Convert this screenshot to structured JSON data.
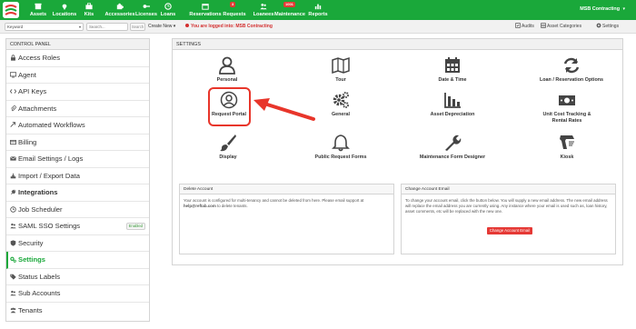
{
  "nav": {
    "items": [
      {
        "label": "Assets",
        "icon": "box-icon"
      },
      {
        "label": "Locations",
        "icon": "map-marker-icon"
      },
      {
        "label": "Kits",
        "icon": "briefcase-icon"
      },
      {
        "label": "Accessories",
        "icon": "puzzle-icon"
      },
      {
        "label": "Licenses",
        "icon": "key-icon"
      },
      {
        "label": "Loans",
        "icon": "clock-icon"
      },
      {
        "label": "Reservations",
        "icon": "calendar-icon"
      },
      {
        "label": "Requests",
        "icon": "envelope-icon",
        "badge": "3"
      },
      {
        "label": "Loanees",
        "icon": "users-icon"
      },
      {
        "label": "Maintenance",
        "icon": "wrench-icon",
        "badge": "1001"
      },
      {
        "label": "Reports",
        "icon": "chart-icon"
      }
    ],
    "user": "MSB Contracting",
    "accent": "#1aa83a"
  },
  "subbar": {
    "keyword": "Keyword",
    "search_placeholder": "Search...",
    "search_button": "Search",
    "create_new": "Create New",
    "logged_in": "You are logged into: MSB Contracting",
    "audits": "Audits",
    "asset_categories": "Asset Categories",
    "settings": "Settings"
  },
  "control_panel": {
    "title": "CONTROL PANEL",
    "items": [
      {
        "label": "Access Roles",
        "icon": "lock-icon"
      },
      {
        "label": "Agent",
        "icon": "monitor-icon"
      },
      {
        "label": "API Keys",
        "icon": "code-icon"
      },
      {
        "label": "Attachments",
        "icon": "paperclip-icon"
      },
      {
        "label": "Automated Workflows",
        "icon": "arrow-icon"
      },
      {
        "label": "Billing",
        "icon": "billing-icon"
      },
      {
        "label": "Email Settings / Logs",
        "icon": "envelope-icon"
      },
      {
        "label": "Import / Export Data",
        "icon": "import-export-icon"
      },
      {
        "label": "Integrations",
        "icon": "plug-icon"
      },
      {
        "label": "Job Scheduler",
        "icon": "clock-icon"
      },
      {
        "label": "SAML SSO Settings",
        "icon": "people-icon",
        "badge": "Enabled"
      },
      {
        "label": "Security",
        "icon": "shield-icon"
      },
      {
        "label": "Settings",
        "icon": "cogs-icon",
        "active": true
      },
      {
        "label": "Status Labels",
        "icon": "tags-icon"
      },
      {
        "label": "Sub Accounts",
        "icon": "users-icon"
      },
      {
        "label": "Tenants",
        "icon": "tenants-icon"
      }
    ]
  },
  "settings_panel": {
    "title": "SETTINGS",
    "tiles": [
      {
        "label": "Personal",
        "icon": "person-icon"
      },
      {
        "label": "Tour",
        "icon": "map-icon"
      },
      {
        "label": "Date & Time",
        "icon": "calendar-icon"
      },
      {
        "label": "Loan / Reservation Options",
        "icon": "refresh-icon"
      },
      {
        "label": "Request Portal",
        "icon": "user-circle-icon"
      },
      {
        "label": "General",
        "icon": "cogs-icon"
      },
      {
        "label": "Asset Depreciation",
        "icon": "bar-chart-icon"
      },
      {
        "label": "Unit Cost Tracking &",
        "label2": "Rental Rates",
        "icon": "money-icon"
      },
      {
        "label": "Display",
        "icon": "paint-brush-icon"
      },
      {
        "label": "Public Request Forms",
        "icon": "bell-icon"
      },
      {
        "label": "Maintenance Form Designer",
        "icon": "wrench-icon"
      },
      {
        "label": "Kiosk",
        "icon": "barcode-scanner-icon"
      }
    ]
  },
  "delete_account": {
    "title": "Delete Account",
    "text": "Your account is configured for multi-tenancy and cannot be deleted from here. Please email support at",
    "email": "help@reftab.com",
    "text_after": " to delete tenants."
  },
  "change_email": {
    "title": "Change Account Email",
    "text": "To change your account email, click the button below. You will supply a new email address. The new email address will replace the email address you are currently using. Any instance where your email is used such as, loan history, asset comments, etc will be replaced with the new one.",
    "button": "Change Account Email"
  },
  "annotation_color": "#e8352a"
}
